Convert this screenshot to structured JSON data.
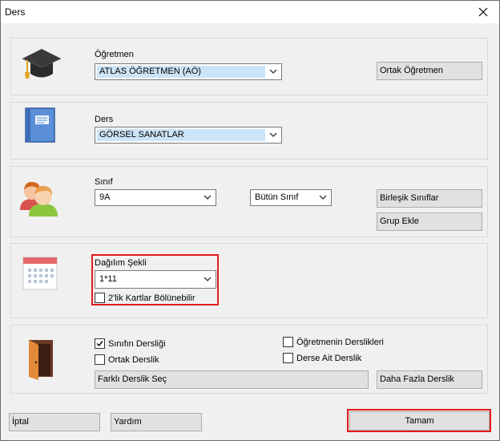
{
  "window": {
    "title": "Ders"
  },
  "teacher": {
    "label": "Öğretmen",
    "value": "ATLAS ÖĞRETMEN (AÖ)",
    "shared_button": "Ortak Öğretmen",
    "icon": "graduation-cap-icon"
  },
  "lesson": {
    "label": "Ders",
    "value": "GÖRSEL SANATLAR",
    "icon": "book-icon"
  },
  "class_section": {
    "label": "Sınıf",
    "value": "9A",
    "scope_value": "Bütün Sınıf",
    "merged_button": "Birleşik Sınıflar",
    "group_button": "Grup Ekle",
    "icon": "students-icon"
  },
  "distribution": {
    "label": "Dağılım Şekli",
    "value": "1*11",
    "split_checkbox": {
      "label": "2'lik Kartlar Bölünebilir",
      "checked": false
    },
    "icon": "calendar-icon"
  },
  "classroom": {
    "class_room": {
      "label": "Sınıfın Dersliği",
      "checked": true
    },
    "shared_room": {
      "label": "Ortak Derslik",
      "checked": false
    },
    "teacher_rooms": {
      "label": "Öğretmenin Derslikleri",
      "checked": false
    },
    "lesson_room": {
      "label": "Derse Ait Derslik",
      "checked": false
    },
    "choose_button": "Farklı Derslik Seç",
    "more_button": "Daha Fazla Derslik",
    "icon": "door-icon"
  },
  "footer": {
    "cancel": "İptal",
    "help": "Yardım",
    "ok": "Tamam"
  },
  "colors": {
    "highlight": "#e21b1b",
    "selection": "#cce4f7",
    "window_bg": "#f0f0f0",
    "button_bg": "#e1e1e1"
  }
}
